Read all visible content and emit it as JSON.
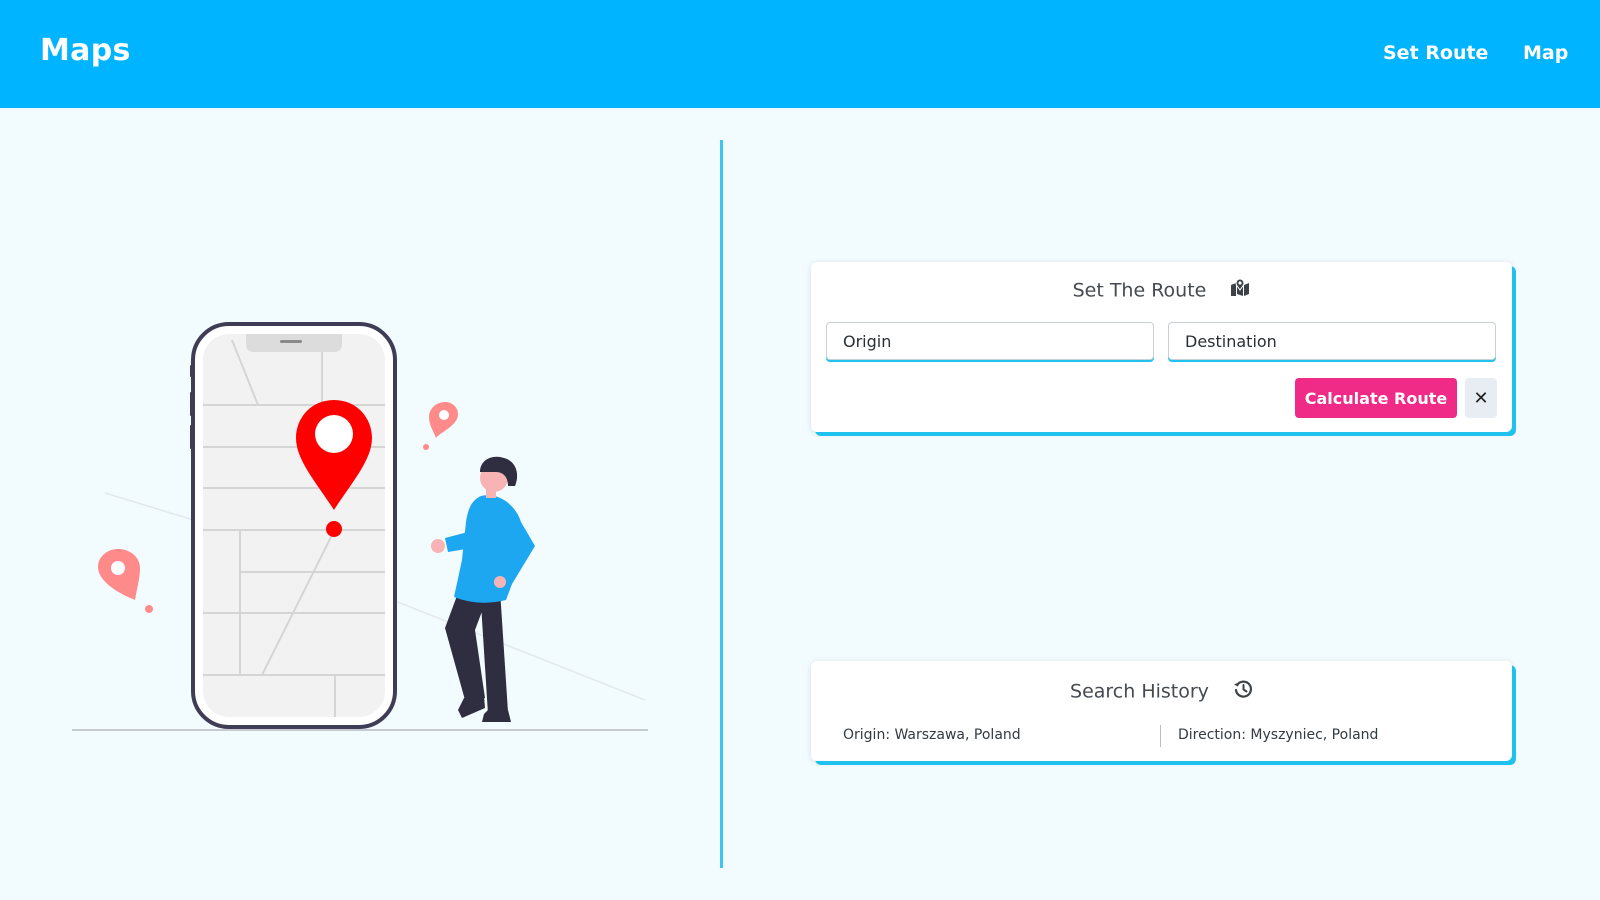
{
  "header": {
    "brand": "Maps",
    "nav": [
      {
        "label": "Set Route"
      },
      {
        "label": "Map"
      }
    ]
  },
  "colors": {
    "header_bg": "#00b4ff",
    "accent": "#1fc2ef",
    "calculate_button": "#f02b87",
    "pin_red": "#ff0000",
    "pin_pink": "#ff8a8a",
    "person_shirt": "#1da7f0"
  },
  "illustration": {
    "icons": [
      "phone-map-illustration",
      "location-pin-icon",
      "person-figure"
    ]
  },
  "route_card": {
    "title": "Set The Route",
    "title_icon": "map-marker-icon",
    "origin_placeholder": "Origin",
    "destination_placeholder": "Destination",
    "calculate_label": "Calculate Route",
    "clear_label": "✕"
  },
  "history_card": {
    "title": "Search History",
    "title_icon": "history-icon",
    "entries": [
      {
        "origin": "Origin: Warszawa, Poland",
        "direction": "Direction: Myszyniec, Poland"
      }
    ]
  }
}
